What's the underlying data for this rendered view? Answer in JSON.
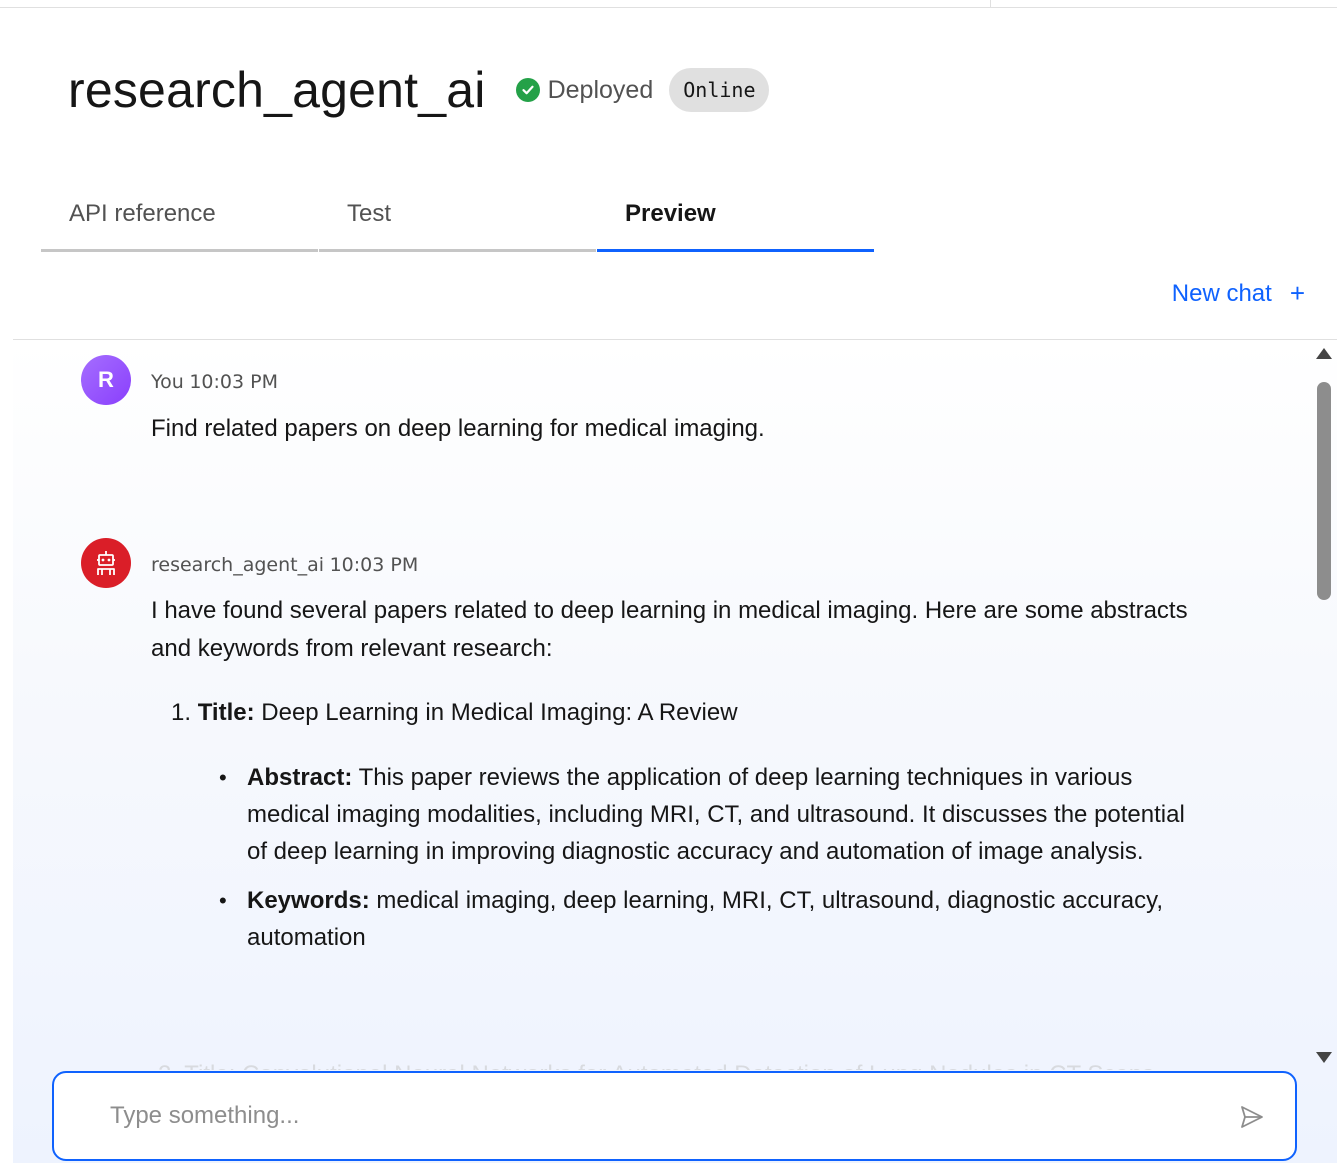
{
  "header": {
    "title": "research_agent_ai",
    "status_label": "Deployed",
    "status_color": "#24a148",
    "badge": "Online"
  },
  "tabs": [
    {
      "label": "API reference",
      "active": false
    },
    {
      "label": "Test",
      "active": false
    },
    {
      "label": "Preview",
      "active": true
    }
  ],
  "new_chat": {
    "label": "New chat",
    "icon": "plus-icon"
  },
  "messages": {
    "user": {
      "avatar_letter": "R",
      "author": "You",
      "time": "10:03 PM",
      "text": "Find related papers on deep learning for medical imaging."
    },
    "bot": {
      "avatar_icon": "robot-icon",
      "author": "research_agent_ai",
      "time": "10:03 PM",
      "intro": "I have found several papers related to deep learning in medical imaging. Here are some abstracts and keywords from relevant research:",
      "items": [
        {
          "number": "1.",
          "title_label": "Title:",
          "title": "Deep Learning in Medical Imaging: A Review",
          "abstract_label": "Abstract:",
          "abstract": "This paper reviews the application of deep learning techniques in various medical imaging modalities, including MRI, CT, and ultrasound. It discusses the potential of deep learning in improving diagnostic accuracy and automation of image analysis.",
          "keywords_label": "Keywords:",
          "keywords": "medical imaging, deep learning, MRI, CT, ultrasound, diagnostic accuracy, automation"
        }
      ],
      "faded_next": "2. Title: Convolutional Neural Networks for Automated Detection of Lung Nodules in CT Scans"
    }
  },
  "input": {
    "placeholder": "Type something...",
    "value": ""
  },
  "colors": {
    "accent": "#0f62fe",
    "bot_avatar": "#da1e28",
    "user_avatar": "#8a3ffc"
  }
}
